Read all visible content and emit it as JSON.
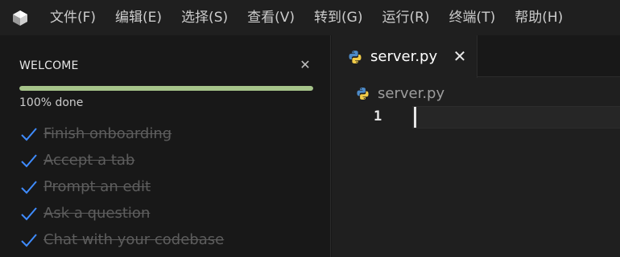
{
  "menubar": {
    "items": [
      "文件(F)",
      "编辑(E)",
      "选择(S)",
      "查看(V)",
      "转到(G)",
      "运行(R)",
      "终端(T)",
      "帮助(H)"
    ]
  },
  "welcome": {
    "title": "WELCOME",
    "progress_percent": 100,
    "progress_text": "100% done",
    "tasks": [
      {
        "label": "Finish onboarding",
        "done": true
      },
      {
        "label": "Accept a tab",
        "done": true
      },
      {
        "label": "Prompt an edit",
        "done": true
      },
      {
        "label": "Ask a question",
        "done": true
      },
      {
        "label": "Chat with your codebase",
        "done": true
      }
    ]
  },
  "editor": {
    "tab": {
      "label": "server.py",
      "icon": "python-icon"
    },
    "breadcrumb": {
      "label": "server.py",
      "icon": "python-icon"
    },
    "line_number": "1"
  },
  "colors": {
    "progress": "#a6c48a",
    "check": "#3f8cff",
    "python_blue": "#4d8bc9",
    "python_yellow": "#f2cc48"
  }
}
